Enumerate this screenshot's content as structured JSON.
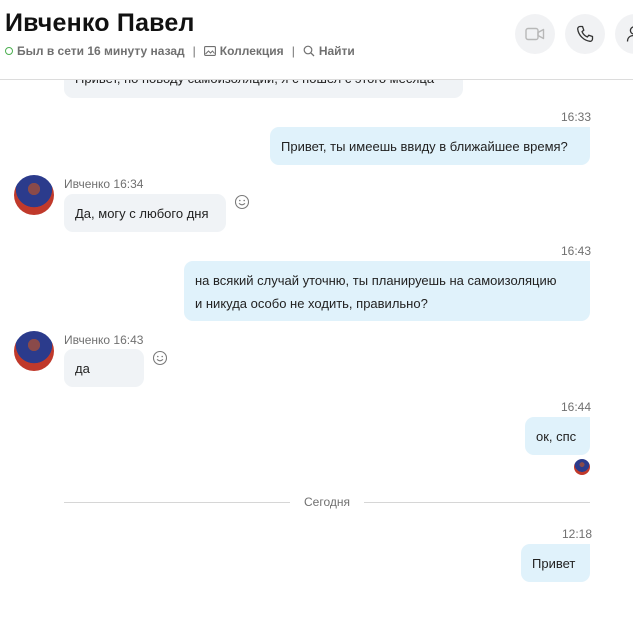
{
  "header": {
    "contact_name": "Ивченко Павел",
    "status": "Был в сети 16 минуту назад",
    "separator": "|",
    "gallery_label": "Коллекция",
    "find_label": "Найти",
    "icons": {
      "video": "video-camera-icon",
      "call": "phone-icon",
      "person": "add-person-icon"
    },
    "status_color": "#4caf50"
  },
  "messages": {
    "m0": {
      "text": "Привет, по поводу самоизоляции, я с пошел с этого месяца"
    },
    "m1": {
      "time": "16:33",
      "text": "Привет, ты имеешь ввиду в ближайшее время?"
    },
    "m2": {
      "sender_time": "Ивченко 16:34",
      "text": "Да, могу с любого дня"
    },
    "m3": {
      "time": "16:43",
      "line1": "на всякий случай уточню, ты планируешь на самоизоляцию",
      "line2": "и никуда особо не ходить, правильно?"
    },
    "m4": {
      "sender_time": "Ивченко 16:43",
      "text": "да"
    },
    "m5": {
      "time": "16:44",
      "text": "ок, спс"
    },
    "divider": "Сегодня",
    "m6": {
      "time": "12:18",
      "text": "Привет"
    }
  },
  "colors": {
    "incoming_bubble": "#f0f3f6",
    "outgoing_bubble": "#e0f2fb"
  }
}
